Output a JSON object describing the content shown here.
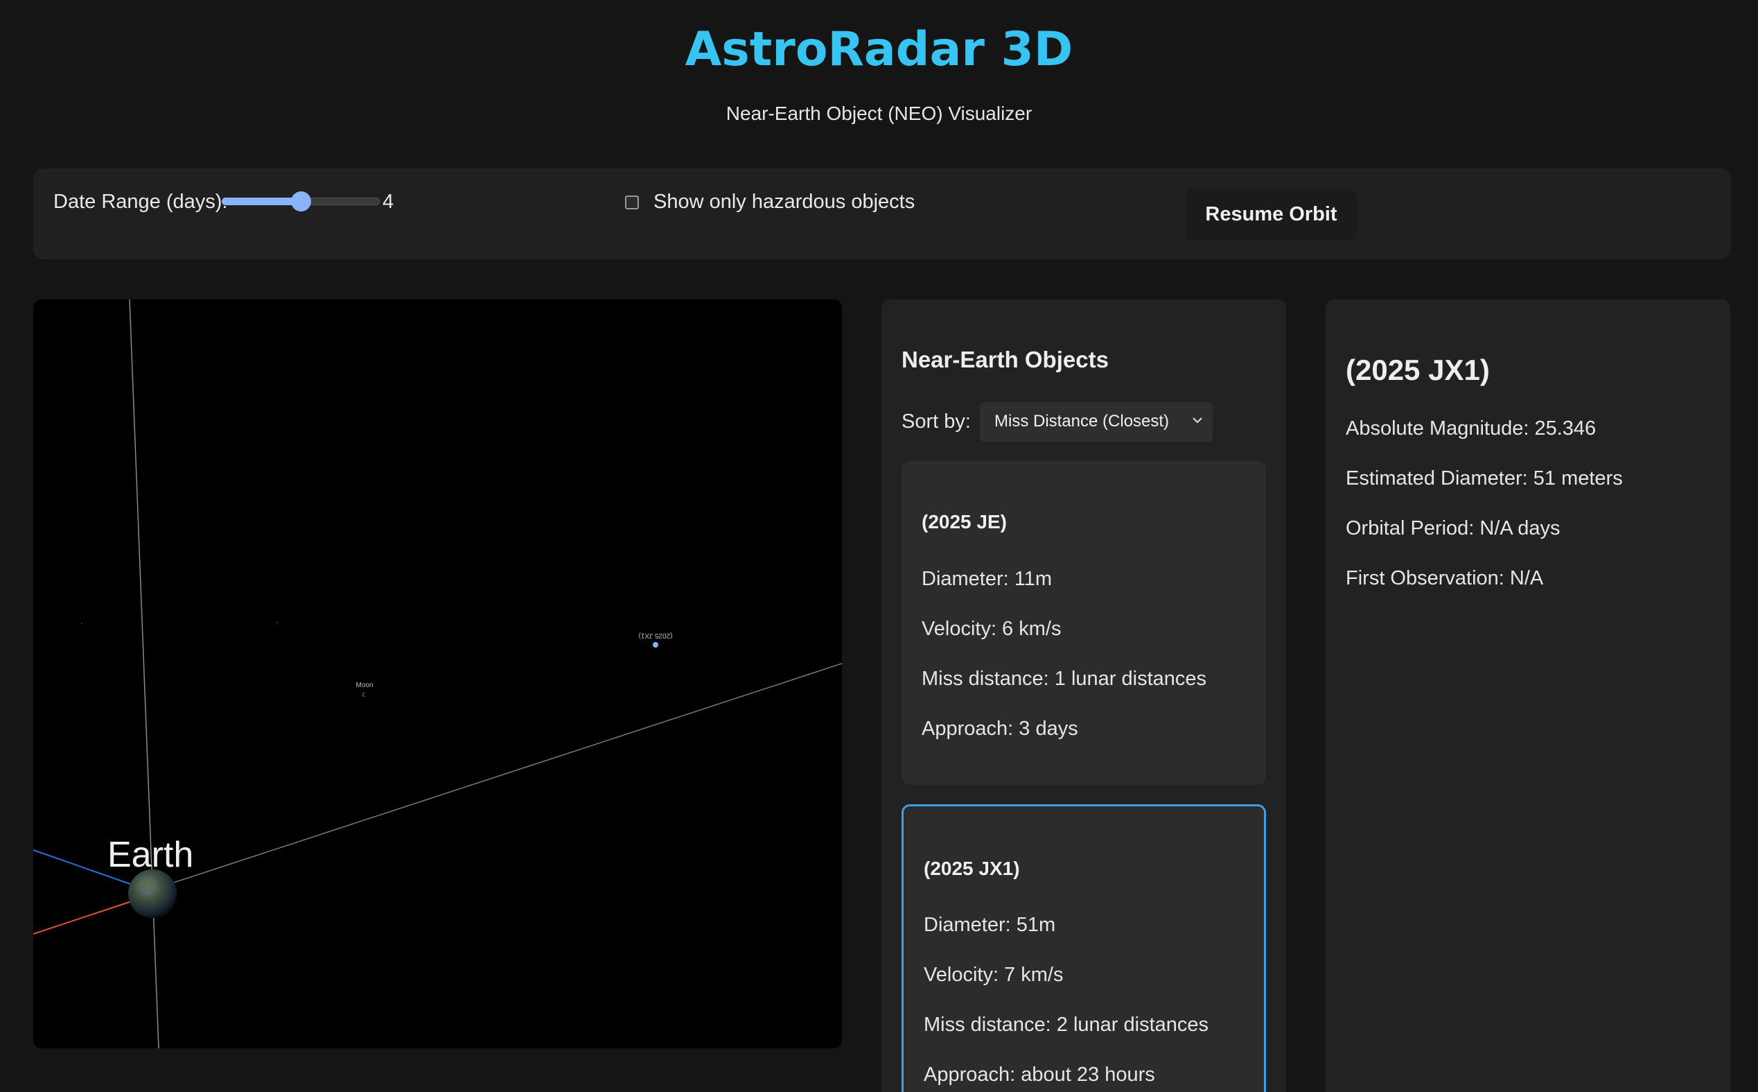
{
  "header": {
    "title": "AstroRadar 3D",
    "subtitle": "Near-Earth Object (NEO) Visualizer"
  },
  "controls": {
    "date_range_label": "Date Range (days):",
    "date_range_value": "4",
    "date_range_min": 1,
    "date_range_max": 7,
    "hazardous_label": "Show only hazardous objects",
    "hazardous_checked": false,
    "resume_button": "Resume Orbit"
  },
  "scene": {
    "earth_label": "Earth",
    "moon_label": "Moon",
    "moon_glyph": "☾",
    "object_label": "(2025 JX1)",
    "colors": {
      "background": "#000000",
      "axis": "#8a8a8a",
      "blue_line": "#2f6de0",
      "orange_line": "#e0552a",
      "object_dot": "#7fb2ff"
    }
  },
  "neo_list": {
    "title": "Near-Earth Objects",
    "sort_label": "Sort by:",
    "sort_value": "Miss Distance (Closest)",
    "items": [
      {
        "name": "(2025 JE)",
        "diameter": "Diameter: 11m",
        "velocity": "Velocity: 6 km/s",
        "miss_distance": "Miss distance: 1 lunar distances",
        "approach": "Approach: 3 days",
        "selected": false
      },
      {
        "name": "(2025 JX1)",
        "diameter": "Diameter: 51m",
        "velocity": "Velocity: 7 km/s",
        "miss_distance": "Miss distance: 2 lunar distances",
        "approach": "Approach: about 23 hours",
        "selected": true
      }
    ]
  },
  "details": {
    "title": "(2025 JX1)",
    "absolute_magnitude": "Absolute Magnitude: 25.346",
    "estimated_diameter": "Estimated Diameter: 51 meters",
    "orbital_period": "Orbital Period: N/A days",
    "first_observation": "First Observation: N/A"
  },
  "colors": {
    "accent_title": "#38c4f2",
    "selected_border": "#3d9fe8",
    "slider": "#8ab4f8"
  }
}
